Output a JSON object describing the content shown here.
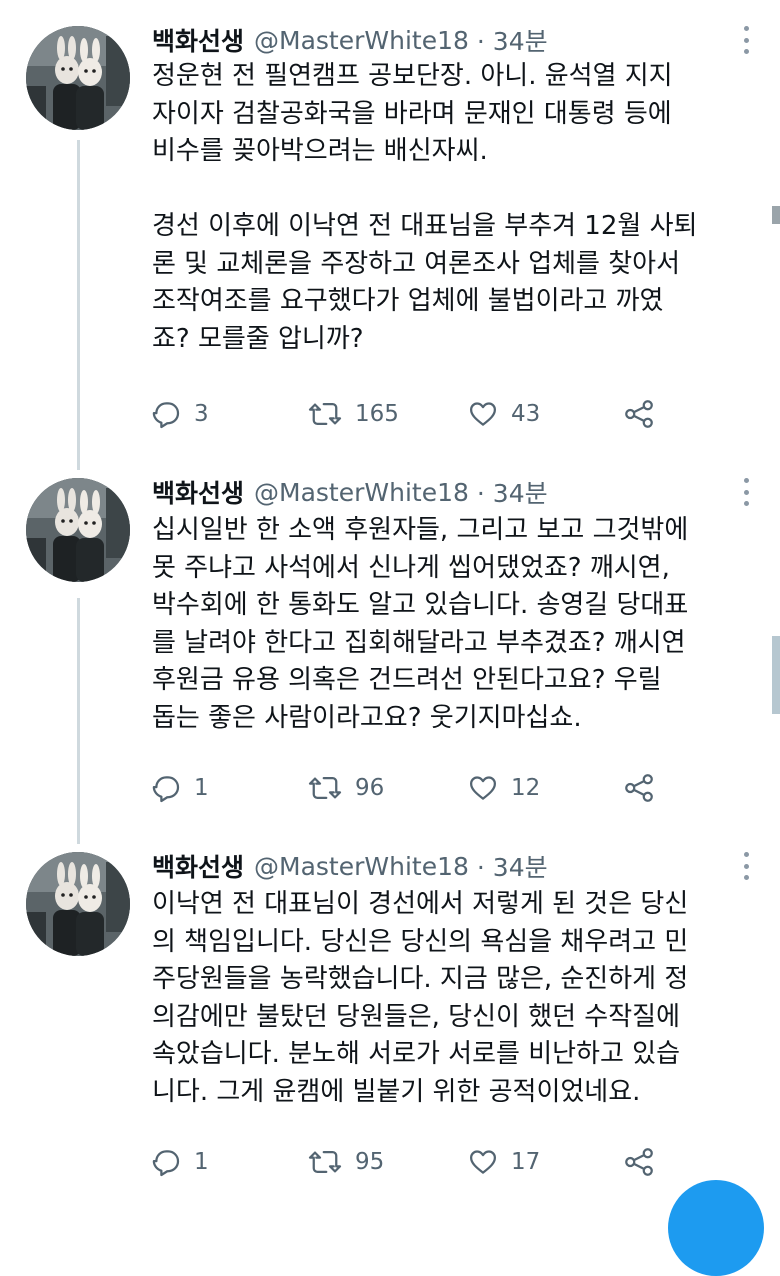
{
  "tweets": [
    {
      "name": "백화선생",
      "handle": "@MasterWhite18",
      "time": "· 34분",
      "avatar_icon": "profile-photo-bunny-masks",
      "lines": [
        "정운현 전 필연캠프 공보단장. 아니. 윤석열 지지",
        "자이자 검찰공화국을 바라며 문재인 대통령 등에",
        "비수를 꽂아박으려는 배신자씨.",
        "",
        "경선 이후에 이낙연 전 대표님을 부추겨 12월 사퇴",
        "론 및 교체론을 주장하고 여론조사 업체를 찾아서",
        "조작여조를 요구했다가 업체에 불법이라고 까였",
        "죠? 모를줄 압니까?"
      ],
      "replies": "3",
      "retweets": "165",
      "likes": "43"
    },
    {
      "name": "백화선생",
      "handle": "@MasterWhite18",
      "time": "· 34분",
      "avatar_icon": "profile-photo-bunny-masks",
      "lines": [
        "십시일반 한 소액 후원자들, 그리고 보고 그것밖에",
        "못 주냐고 사석에서 신나게 씹어댔었죠? 깨시연,",
        "박수회에 한 통화도 알고 있습니다. 송영길 당대표",
        "를 날려야 한다고 집회해달라고 부추겼죠? 깨시연",
        "후원금 유용 의혹은 건드려선 안된다고요? 우릴",
        "돕는 좋은 사람이라고요? 웃기지마십쇼."
      ],
      "replies": "1",
      "retweets": "96",
      "likes": "12"
    },
    {
      "name": "백화선생",
      "handle": "@MasterWhite18",
      "time": "· 34분",
      "avatar_icon": "profile-photo-bunny-masks",
      "lines": [
        "이낙연 전 대표님이 경선에서 저렇게 된 것은 당신",
        "의 책임입니다. 당신은 당신의 욕심을 채우려고 민",
        "주당원들을 농락했습니다. 지금 많은, 순진하게 정",
        "의감에만 불탔던 당원들은, 당신이 했던 수작질에",
        "속았습니다. 분노해 서로가 서로를 비난하고 있습",
        "니다. 그게 윤캠에 빌붙기 위한 공적이었네요."
      ],
      "replies": "1",
      "retweets": "95",
      "likes": "17"
    }
  ],
  "icons": {
    "reply": "reply-icon",
    "retweet": "retweet-icon",
    "like": "like-icon",
    "share": "share-icon",
    "more": "more-icon"
  },
  "colors": {
    "text": "#0f1419",
    "secondary": "#536471",
    "thread_line": "#cfd9de",
    "accent": "#1d9bf0"
  }
}
